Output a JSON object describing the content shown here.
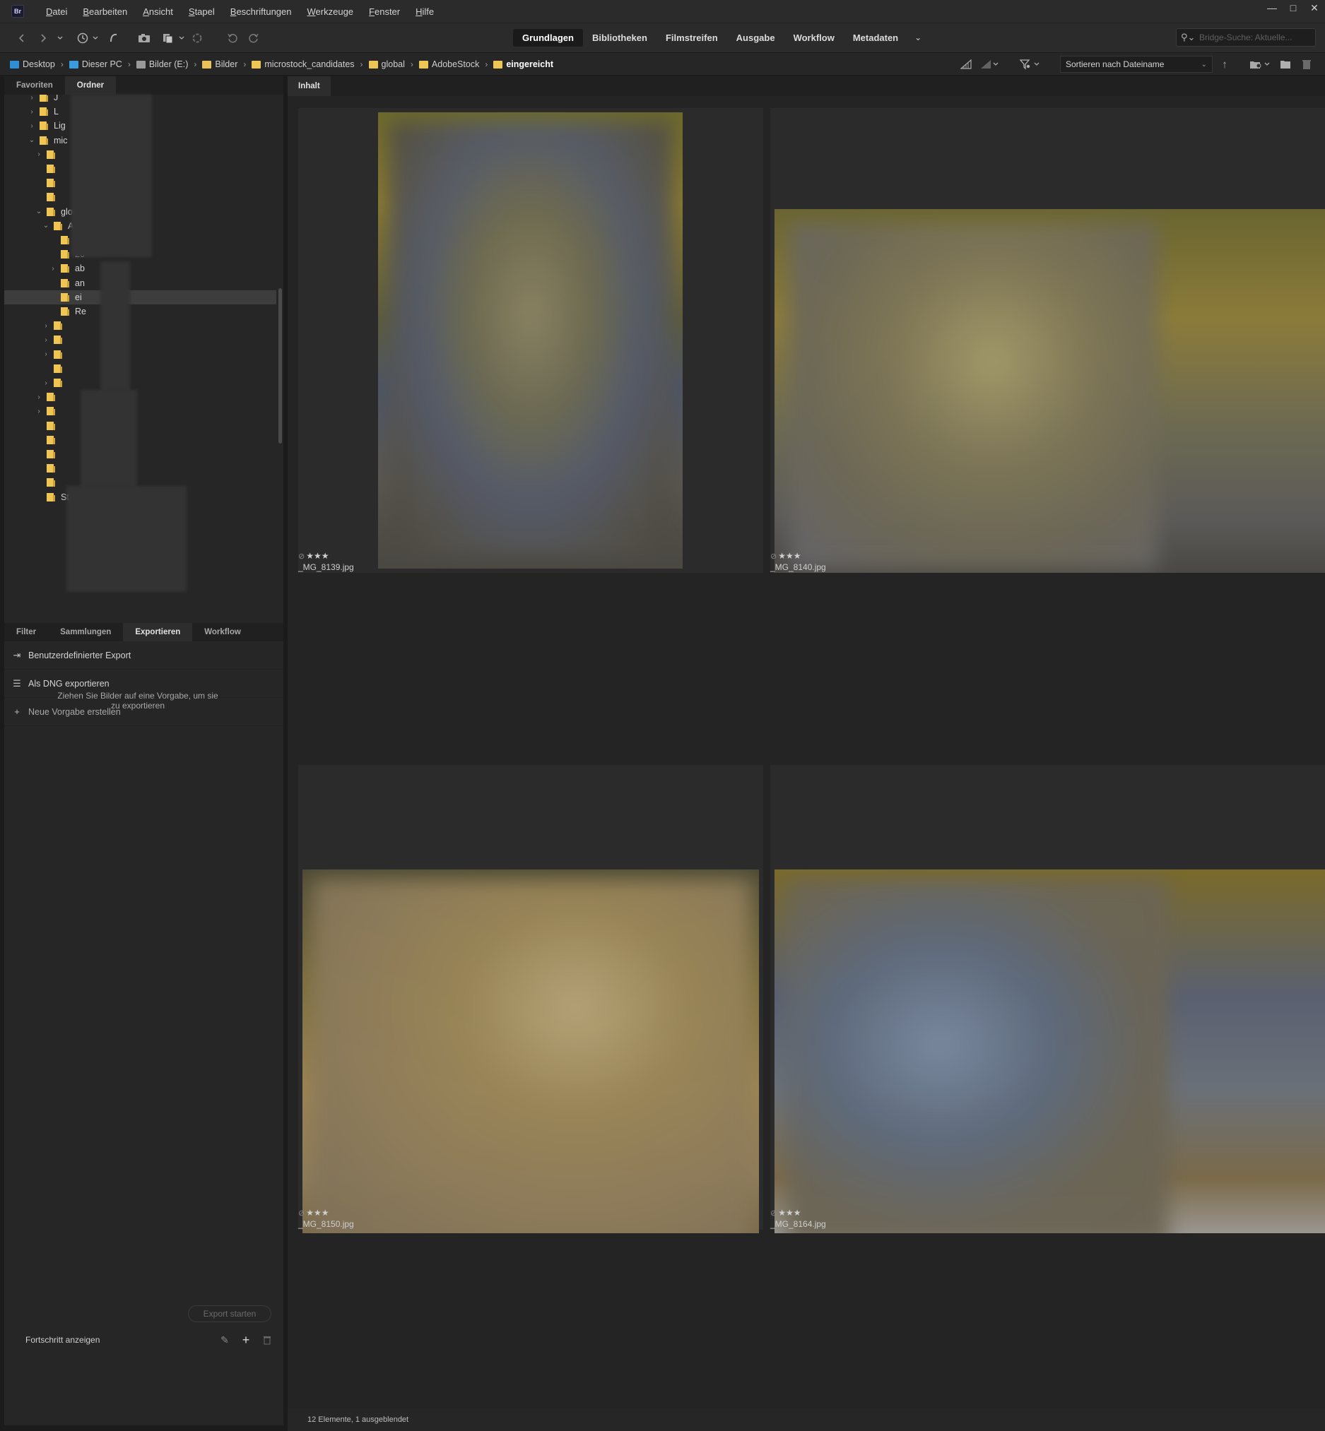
{
  "app": {
    "logo_text": "Br"
  },
  "menu": [
    "Datei",
    "Bearbeiten",
    "Ansicht",
    "Stapel",
    "Beschriftungen",
    "Werkzeuge",
    "Fenster",
    "Hilfe"
  ],
  "window_controls": {
    "minimize": "—",
    "maximize": "□",
    "close": "✕"
  },
  "toolbar": {
    "workspaces": [
      "Grundlagen",
      "Bibliotheken",
      "Filmstreifen",
      "Ausgabe",
      "Workflow",
      "Metadaten"
    ],
    "active_workspace": "Grundlagen",
    "more": "⌄",
    "search_placeholder": "Bridge-Suche: Aktuelle...",
    "icons": [
      "back-icon",
      "forward-icon",
      "history-icon",
      "boomerang-icon",
      "camera-icon",
      "copy-icon",
      "refine-icon",
      "rotate-left-icon",
      "rotate-right-icon"
    ]
  },
  "breadcrumb": [
    {
      "label": "Desktop",
      "icon": "desktop",
      "color": "#2f8fd6"
    },
    {
      "label": "Dieser PC",
      "icon": "pc",
      "color": "#3a9be0"
    },
    {
      "label": "Bilder (E:)",
      "icon": "drive",
      "color": "#9a9a9a"
    },
    {
      "label": "Bilder",
      "icon": "pictures-folder",
      "color": "#e9c35a"
    },
    {
      "label": "microstock_candidates",
      "icon": "folder",
      "color": "#efc553"
    },
    {
      "label": "global",
      "icon": "folder",
      "color": "#efc553"
    },
    {
      "label": "AdobeStock",
      "icon": "folder",
      "color": "#efc553"
    },
    {
      "label": "eingereicht",
      "icon": "folder",
      "color": "#efc553"
    }
  ],
  "sort": {
    "label": "Sortieren nach Dateiname",
    "direction_icon": "↑"
  },
  "left_tabs": [
    "Favoriten",
    "Ordner"
  ],
  "left_active_tab": "Ordner",
  "folder_tree": [
    {
      "label": "J",
      "depth": 3,
      "twisty": "›"
    },
    {
      "label": "L",
      "depth": 3,
      "twisty": "›"
    },
    {
      "label": "Lig",
      "depth": 3,
      "twisty": "›"
    },
    {
      "label": "mic",
      "depth": 3,
      "twisty": "⌄"
    },
    {
      "label": "",
      "depth": 4,
      "twisty": "›"
    },
    {
      "label": "",
      "depth": 4,
      "twisty": ""
    },
    {
      "label": "",
      "depth": 4,
      "twisty": ""
    },
    {
      "label": "",
      "depth": 4,
      "twisty": ""
    },
    {
      "label": "global",
      "depth": 4,
      "twisty": "⌄"
    },
    {
      "label": "Adob",
      "depth": 5,
      "twisty": "⌄"
    },
    {
      "label": "20",
      "depth": 6,
      "twisty": ""
    },
    {
      "label": "20",
      "depth": 6,
      "twisty": ""
    },
    {
      "label": "ab",
      "depth": 6,
      "twisty": "›"
    },
    {
      "label": "an        nen",
      "depth": 6,
      "twisty": ""
    },
    {
      "label": "ei           t",
      "depth": 6,
      "twisty": "",
      "selected": true
    },
    {
      "label": "Re",
      "depth": 6,
      "twisty": ""
    },
    {
      "label": "",
      "depth": 5,
      "twisty": "›"
    },
    {
      "label": "",
      "depth": 5,
      "twisty": "›"
    },
    {
      "label": "",
      "depth": 5,
      "twisty": "›"
    },
    {
      "label": "",
      "depth": 5,
      "twisty": ""
    },
    {
      "label": "",
      "depth": 5,
      "twisty": "›"
    },
    {
      "label": "",
      "depth": 4,
      "twisty": "›"
    },
    {
      "label": "",
      "depth": 4,
      "twisty": "›"
    },
    {
      "label": "",
      "depth": 4,
      "twisty": ""
    },
    {
      "label": "",
      "depth": 4,
      "twisty": ""
    },
    {
      "label": "                 s",
      "depth": 4,
      "twisty": ""
    },
    {
      "label": "",
      "depth": 4,
      "twisty": ""
    },
    {
      "label": "",
      "depth": 4,
      "twisty": ""
    },
    {
      "label": "Statistik",
      "depth": 4,
      "twisty": ""
    }
  ],
  "bottom_tabs": [
    "Filter",
    "Sammlungen",
    "Exportieren",
    "Workflow"
  ],
  "bottom_active_tab": "Exportieren",
  "export": {
    "items": [
      {
        "label": "Benutzerdefinierter Export",
        "icon": "export-icon"
      },
      {
        "label": "Als DNG exportieren",
        "icon": "list-icon"
      },
      {
        "label": "Neue Vorgabe erstellen",
        "icon": "plus-icon"
      }
    ],
    "hint": "Ziehen Sie Bilder auf eine Vorgabe, um sie zu exportieren",
    "start_button": "Export starten",
    "progress_link": "Fortschritt anzeigen"
  },
  "content": {
    "tab": "Inhalt",
    "thumbnails": [
      {
        "filename": "_MG_8139.jpg",
        "rating": 3,
        "orientation": "portrait"
      },
      {
        "filename": "_MG_8140.jpg",
        "rating": 3,
        "orientation": "landscape"
      },
      {
        "filename": "_MG_8150.jpg",
        "rating": 3,
        "orientation": "landscape"
      },
      {
        "filename": "_MG_8164.jpg",
        "rating": 3,
        "orientation": "landscape"
      }
    ],
    "status": "12 Elemente, 1 ausgeblendet"
  }
}
